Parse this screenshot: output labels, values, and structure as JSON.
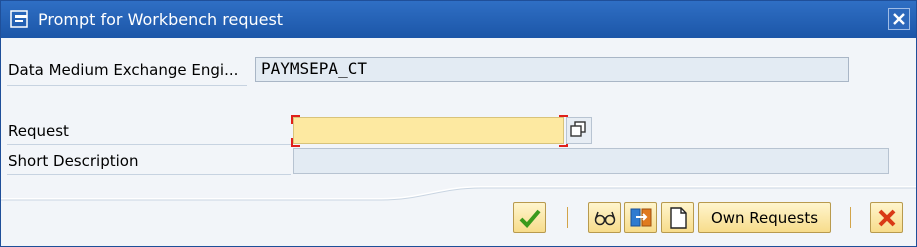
{
  "window": {
    "title": "Prompt for Workbench request",
    "title_icon": "prompt-window-icon",
    "close_icon": "close-icon"
  },
  "form": {
    "engine_label": "Data Medium Exchange Engi...",
    "engine_value": "PAYMSEPA_CT",
    "request_label": "Request",
    "request_value": "",
    "request_f4_icon": "value-help-icon",
    "short_desc_label": "Short Description",
    "short_desc_value": ""
  },
  "toolbar": {
    "continue_icon": "checkmark-icon",
    "glasses_icon": "glasses-icon",
    "transport_icon": "transport-icon",
    "new_icon": "new-document-icon",
    "own_requests_label": "Own Requests",
    "cancel_icon": "cancel-icon"
  },
  "colors": {
    "titlebar": "#1c56a8",
    "required_field": "#fde9a1",
    "button": "#f7dc8b",
    "checkmark": "#3a9a1c",
    "cancel": "#d93a16"
  }
}
